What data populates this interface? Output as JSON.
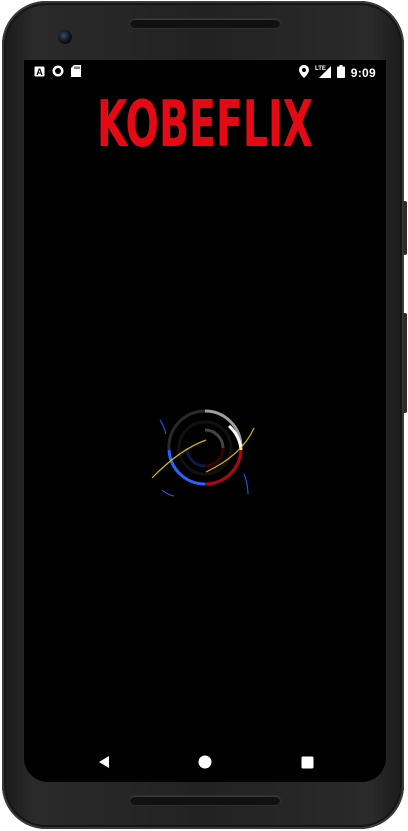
{
  "app": {
    "brand_title": "KOBEFLIX",
    "brand_color": "#e50914",
    "background_color": "#000000"
  },
  "statusbar": {
    "time": "9:09",
    "left_icons": [
      "accessibility-a-icon",
      "record-icon",
      "sd-card-icon"
    ],
    "right_icons": [
      "location-pin-icon",
      "lte-signal-icon",
      "battery-icon"
    ],
    "network_label": "LTE"
  },
  "loading": {
    "colors": [
      "#ffffff",
      "#e50914",
      "#2962ff",
      "#ffd600"
    ]
  },
  "navbar": {
    "buttons": [
      "back-icon",
      "home-icon",
      "recents-icon"
    ]
  }
}
